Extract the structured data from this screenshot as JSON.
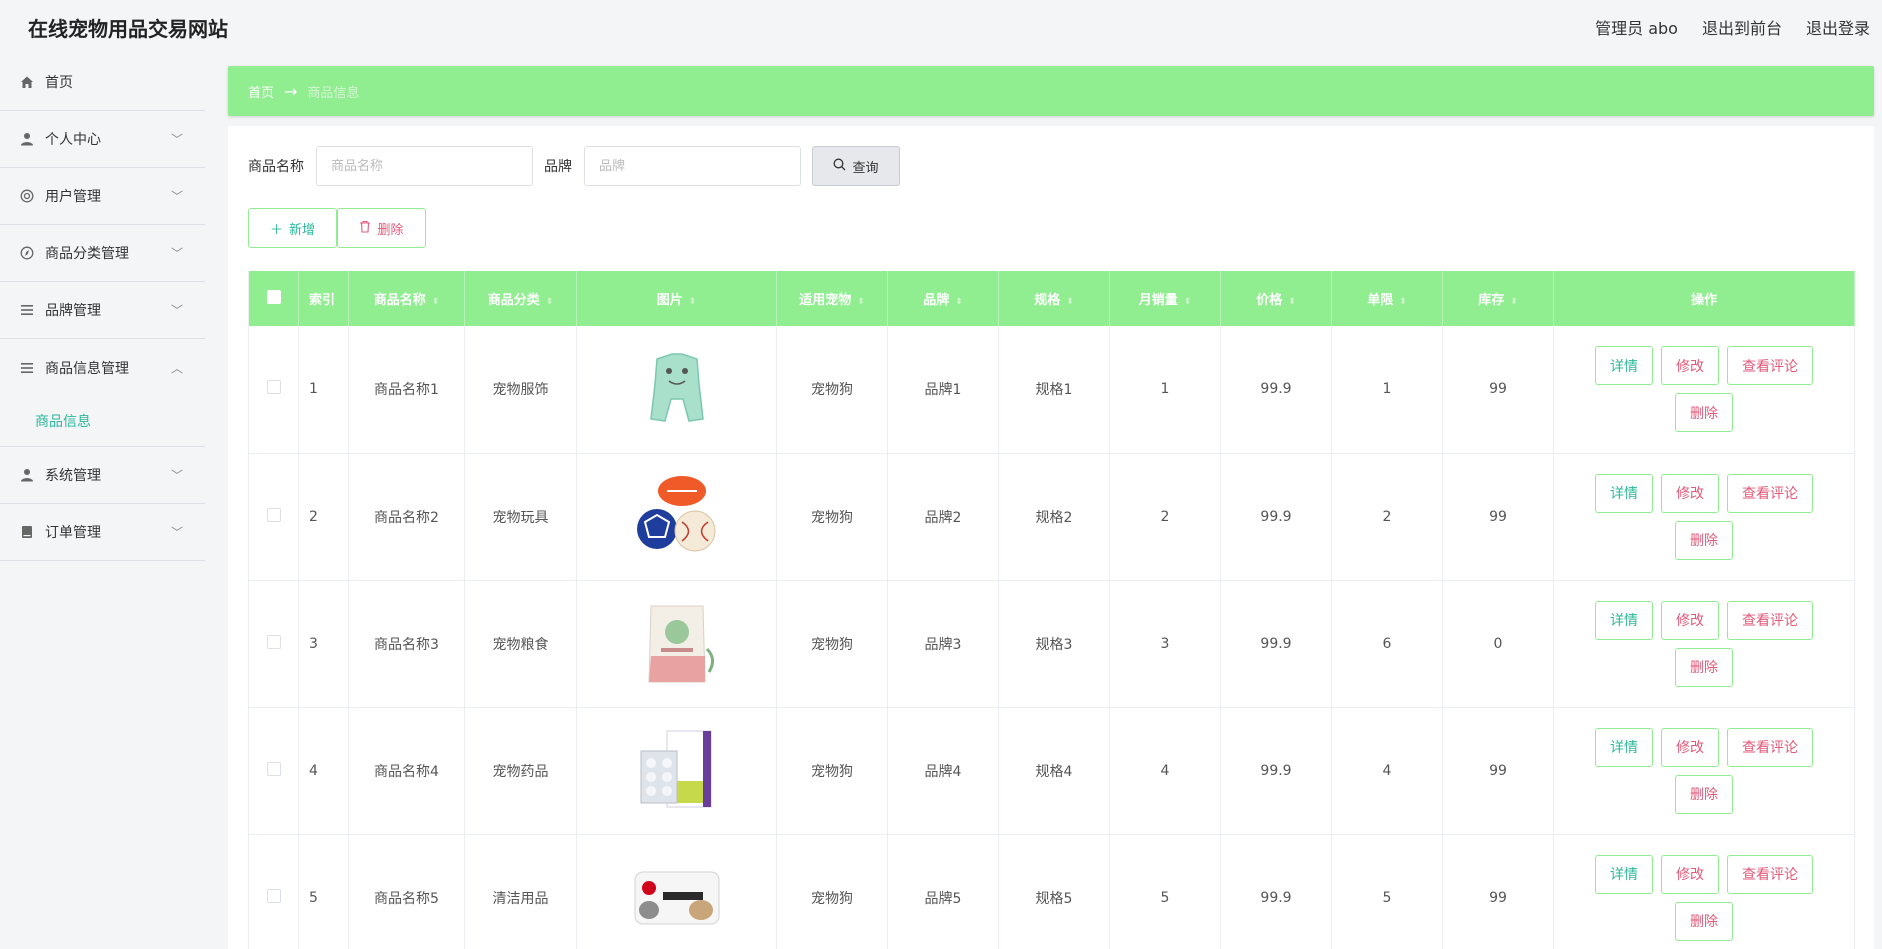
{
  "header": {
    "title": "在线宠物用品交易网站",
    "admin_label": "管理员 abo",
    "front_link": "退出到前台",
    "logout_link": "退出登录"
  },
  "sidebar": {
    "items": [
      {
        "label": "首页",
        "icon": "home-icon"
      },
      {
        "label": "个人中心",
        "icon": "user-icon"
      },
      {
        "label": "用户管理",
        "icon": "users-icon"
      },
      {
        "label": "商品分类管理",
        "icon": "compass-icon"
      },
      {
        "label": "品牌管理",
        "icon": "list-icon"
      },
      {
        "label": "商品信息管理",
        "icon": "list-icon"
      },
      {
        "label": "系统管理",
        "icon": "user-icon"
      },
      {
        "label": "订单管理",
        "icon": "book-icon"
      }
    ],
    "active_sub": "商品信息"
  },
  "breadcrumb": {
    "home": "首页",
    "separator": "→",
    "current": "商品信息"
  },
  "search": {
    "name_label": "商品名称",
    "name_placeholder": "商品名称",
    "brand_label": "品牌",
    "brand_placeholder": "品牌",
    "query_button": "查询"
  },
  "actions": {
    "add": "新增",
    "delete": "删除"
  },
  "table": {
    "headers": {
      "index": "索引",
      "name": "商品名称",
      "category": "商品分类",
      "image": "图片",
      "pet": "适用宠物",
      "brand": "品牌",
      "spec": "规格",
      "monthly_sales": "月销量",
      "price": "价格",
      "limit": "单限",
      "stock": "库存",
      "ops": "操作"
    },
    "op_labels": {
      "detail": "详情",
      "edit": "修改",
      "review": "查看评论",
      "remove": "删除"
    },
    "rows": [
      {
        "index": "1",
        "name": "商品名称1",
        "category": "宠物服饰",
        "image": "pet-clothing",
        "pet": "宠物狗",
        "brand": "品牌1",
        "spec": "规格1",
        "monthly_sales": "1",
        "price": "99.9",
        "limit": "1",
        "stock": "99"
      },
      {
        "index": "2",
        "name": "商品名称2",
        "category": "宠物玩具",
        "image": "pet-toy-balls",
        "pet": "宠物狗",
        "brand": "品牌2",
        "spec": "规格2",
        "monthly_sales": "2",
        "price": "99.9",
        "limit": "2",
        "stock": "99"
      },
      {
        "index": "3",
        "name": "商品名称3",
        "category": "宠物粮食",
        "image": "pet-food-bag",
        "pet": "宠物狗",
        "brand": "品牌3",
        "spec": "规格3",
        "monthly_sales": "3",
        "price": "99.9",
        "limit": "6",
        "stock": "0"
      },
      {
        "index": "4",
        "name": "商品名称4",
        "category": "宠物药品",
        "image": "pet-medicine",
        "pet": "宠物狗",
        "brand": "品牌4",
        "spec": "规格4",
        "monthly_sales": "4",
        "price": "99.9",
        "limit": "4",
        "stock": "99"
      },
      {
        "index": "5",
        "name": "商品名称5",
        "category": "清洁用品",
        "image": "pet-wipes",
        "pet": "宠物狗",
        "brand": "品牌5",
        "spec": "规格5",
        "monthly_sales": "5",
        "price": "99.9",
        "limit": "5",
        "stock": "99"
      }
    ]
  },
  "colors": {
    "accent": "#90ee90",
    "link": "#2bb89a",
    "danger": "#e05a7a"
  }
}
